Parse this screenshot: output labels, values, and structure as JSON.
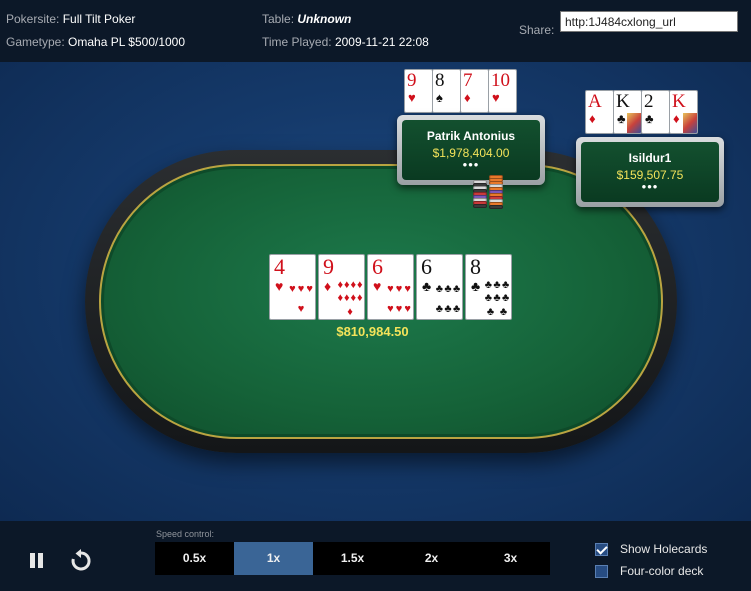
{
  "header": {
    "pokersite_label": "Pokersite:",
    "pokersite": "Full Tilt Poker",
    "gametype_label": "Gametype:",
    "gametype": "Omaha PL $500/1000",
    "table_label": "Table:",
    "table": "Unknown",
    "time_label": "Time Played:",
    "time": "2009-11-21 22:08",
    "share_label": "Share:",
    "share_value": "http:1J484cxlong_url"
  },
  "players": [
    {
      "name": "Patrik Antonius",
      "stack": "$1,978,404.00",
      "dots": "•••",
      "cards": [
        {
          "rank": "9",
          "suit": "♥",
          "color": "red"
        },
        {
          "rank": "8",
          "suit": "♠",
          "color": "black"
        },
        {
          "rank": "7",
          "suit": "♦",
          "color": "red"
        },
        {
          "rank": "10",
          "suit": "♥",
          "color": "red"
        }
      ]
    },
    {
      "name": "Isildur1",
      "stack": "$159,507.75",
      "dots": "•••",
      "cards": [
        {
          "rank": "A",
          "suit": "♦",
          "color": "red"
        },
        {
          "rank": "K",
          "suit": "♣",
          "color": "black"
        },
        {
          "rank": "2",
          "suit": "♣",
          "color": "black"
        },
        {
          "rank": "K",
          "suit": "♦",
          "color": "red"
        }
      ]
    }
  ],
  "board": [
    {
      "rank": "4",
      "suit": "♥",
      "color": "red"
    },
    {
      "rank": "9",
      "suit": "♦",
      "color": "red"
    },
    {
      "rank": "6",
      "suit": "♥",
      "color": "red"
    },
    {
      "rank": "6",
      "suit": "♣",
      "color": "black"
    },
    {
      "rank": "8",
      "suit": "♣",
      "color": "black"
    }
  ],
  "pot": "$810,984.50",
  "controls": {
    "speed_label": "Speed control:",
    "speeds": [
      "0.5x",
      "1x",
      "1.5x",
      "2x",
      "3x"
    ],
    "active_speed": "1x",
    "show_holecards_label": "Show Holecards",
    "show_holecards": true,
    "four_color_label": "Four-color deck",
    "four_color": false
  },
  "colors": {
    "felt": "#156238",
    "accent": "#3a6596",
    "stack_text": "#f3e35a",
    "red_suit": "#d0101b"
  }
}
